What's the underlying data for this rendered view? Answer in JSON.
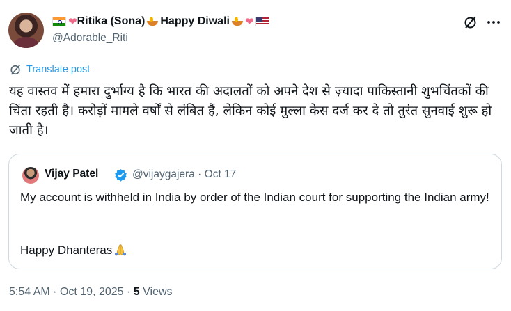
{
  "author": {
    "display_name_parts": [
      "Ritika (Sona)",
      "Happy Diwali"
    ],
    "handle": "@Adorable_Riti"
  },
  "translate": {
    "label": "Translate post"
  },
  "post": {
    "text": "यह वास्तव में हमारा दुर्भाग्य है कि भारत की अदालतों को अपने देश से ज़्यादा पाकिस्तानी शुभचिंतकों की चिंता रहती है। करोड़ों मामले वर्षों से लंबित हैं, लेकिन कोई मुल्ला केस दर्ज कर दे तो तुरंत सुनवाई शुरू हो जाती है।"
  },
  "quote": {
    "name": "Vijay Patel",
    "handle": "@vijaygajera",
    "separator": "·",
    "date": "Oct 17",
    "text": "My account is withheld in India by order of the Indian court for supporting the Indian army!",
    "text2": "Happy Dhanteras"
  },
  "meta": {
    "time": "5:54 AM",
    "separator": "·",
    "date": "Oct 19, 2025",
    "views_count": "5",
    "views_label": "Views"
  },
  "icons": [
    "flag-india-icon",
    "heart-icon",
    "diya-icon",
    "flag-usa-icon",
    "grok-icon",
    "more-icon",
    "translate-icon",
    "verified-icon",
    "folded-hands-icon"
  ],
  "colors": {
    "link": "#1d9bf0",
    "secondary": "#536471",
    "text": "#0f1419",
    "border": "#cfd9de"
  }
}
